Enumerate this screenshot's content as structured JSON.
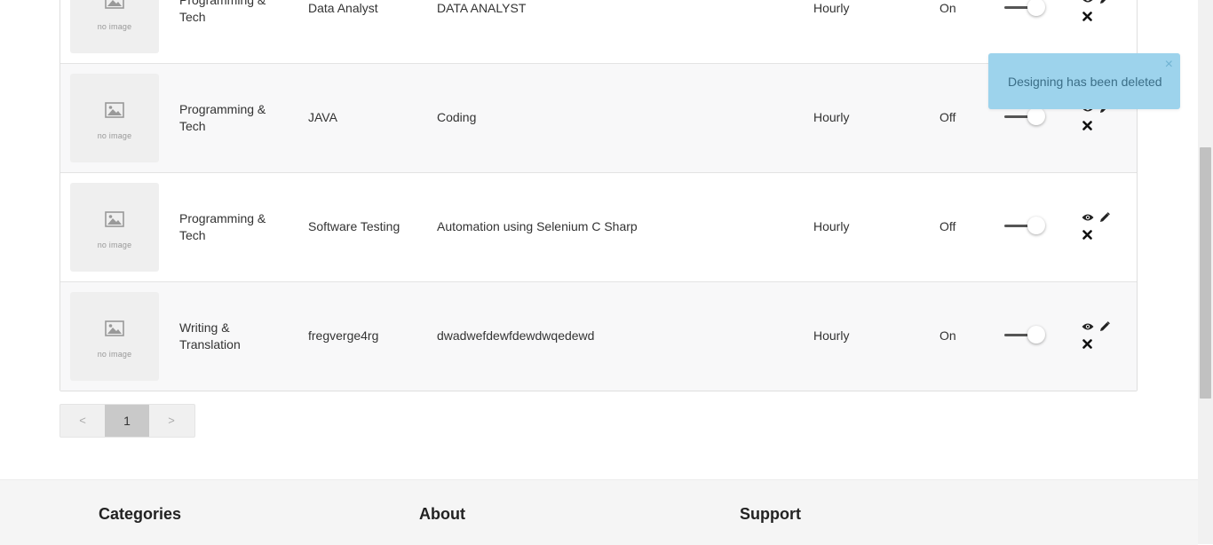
{
  "table": {
    "rows": [
      {
        "category": "Programming & Tech",
        "no_image": "no image",
        "subcategory": "Data Analyst",
        "title": "DATA ANALYST",
        "type": "Hourly",
        "status": "On"
      },
      {
        "category": "Programming & Tech",
        "no_image": "no image",
        "subcategory": "JAVA",
        "title": "Coding",
        "type": "Hourly",
        "status": "Off"
      },
      {
        "category": "Programming & Tech",
        "no_image": "no image",
        "subcategory": "Software Testing",
        "title": "Automation using Selenium C Sharp",
        "type": "Hourly",
        "status": "Off"
      },
      {
        "category": "Writing & Translation",
        "no_image": "no image",
        "subcategory": "fregverge4rg",
        "title": "dwadwefdewfdewdwqedewd",
        "type": "Hourly",
        "status": "On"
      }
    ]
  },
  "pagination": {
    "prev": "<",
    "current": "1",
    "next": ">"
  },
  "footer": {
    "col1": "Categories",
    "col2": "About",
    "col3": "Support"
  },
  "toast": {
    "message": "Designing has been deleted",
    "close": "×"
  },
  "icons": {
    "image": "image-placeholder-icon",
    "view": "eye-icon",
    "edit": "pencil-icon",
    "delete": "close-icon"
  },
  "colors": {
    "toast_bg": "#9dd3ec",
    "pager_active": "#c9c9c9",
    "row_alt": "#f8f8f9"
  }
}
